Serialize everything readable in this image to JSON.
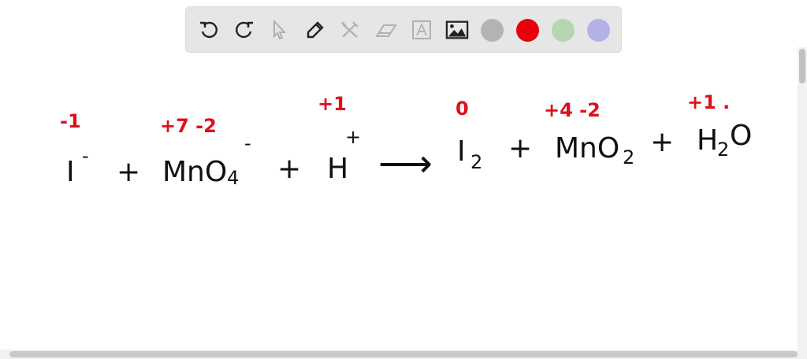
{
  "toolbar": {
    "tools": [
      "undo-icon",
      "redo-icon",
      "pointer-icon",
      "pen-icon",
      "tools-icon",
      "eraser-icon",
      "text-icon",
      "image-icon"
    ],
    "colors": [
      "#b3b3b3",
      "#e8000b",
      "#b5d6b2",
      "#b4b1e6"
    ]
  },
  "equation": {
    "reactant1": "I",
    "reactant1_charge": "-",
    "plus1": "+",
    "reactant2": "MnO",
    "reactant2_sub": "4",
    "reactant2_charge": "-",
    "plus2": "+",
    "reactant3": "H",
    "reactant3_charge": "+",
    "arrow": "⟶",
    "product1": "I",
    "product1_sub": "2",
    "plus3": "+",
    "product2": "MnO",
    "product2_sub": "2",
    "plus4": "+",
    "product3_a": "H",
    "product3_sub": "2",
    "product3_b": "O"
  },
  "oxidation_states": {
    "i_minus": "-1",
    "mno4": "+7 -2",
    "h_plus": "+1",
    "i2": "0",
    "mno2": "+4 -2",
    "h2o": "+1 ."
  }
}
